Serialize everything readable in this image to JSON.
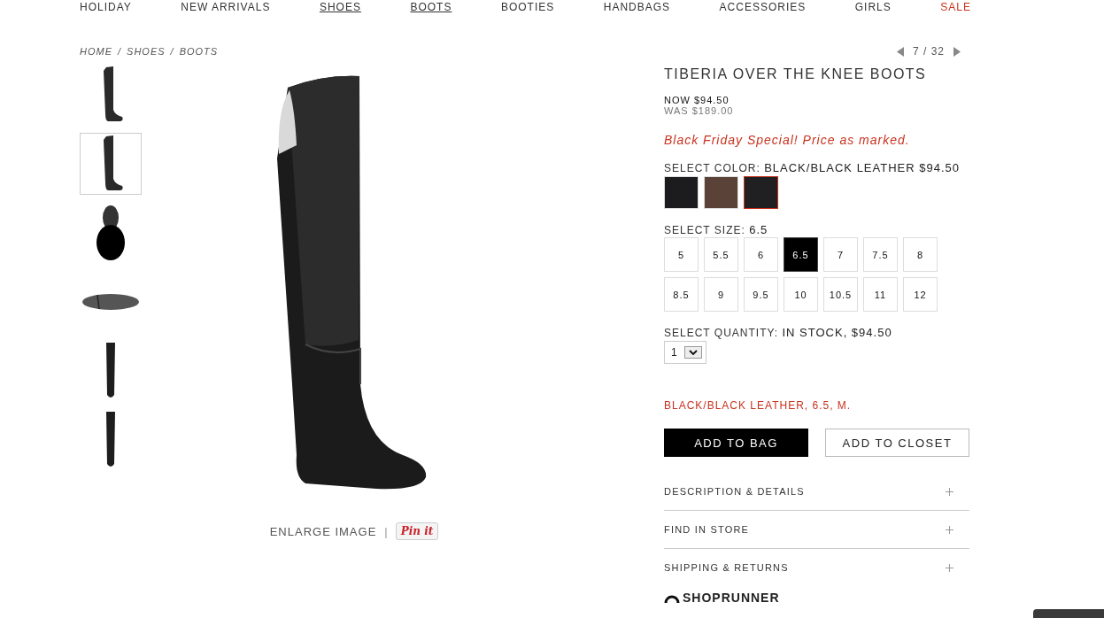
{
  "nav": [
    {
      "label": "HOLIDAY",
      "selected": false,
      "kind": "normal"
    },
    {
      "label": "NEW ARRIVALS",
      "selected": false,
      "kind": "normal"
    },
    {
      "label": "SHOES",
      "selected": true,
      "kind": "normal"
    },
    {
      "label": "BOOTS",
      "selected": true,
      "kind": "normal"
    },
    {
      "label": "BOOTIES",
      "selected": false,
      "kind": "normal"
    },
    {
      "label": "HANDBAGS",
      "selected": false,
      "kind": "normal"
    },
    {
      "label": "ACCESSORIES",
      "selected": false,
      "kind": "normal"
    },
    {
      "label": "GIRLS",
      "selected": false,
      "kind": "normal"
    },
    {
      "label": "SALE",
      "selected": false,
      "kind": "sale"
    }
  ],
  "breadcrumb": [
    "HOME",
    "SHOES",
    "BOOTS"
  ],
  "breadcrumb_separator": "/",
  "thumbnails": [
    {
      "kind": "side",
      "selected": false
    },
    {
      "kind": "side",
      "selected": true
    },
    {
      "kind": "top",
      "selected": false
    },
    {
      "kind": "sole",
      "selected": false
    },
    {
      "kind": "front",
      "selected": false
    },
    {
      "kind": "back",
      "selected": false
    }
  ],
  "image_actions": {
    "enlarge": "ENLARGE IMAGE",
    "separator": "|",
    "pin": "Pin it"
  },
  "pager": "7 / 32",
  "product": {
    "title": "TIBERIA OVER THE KNEE BOOTS",
    "now_price": "NOW $94.50",
    "was_price": "WAS $189.00",
    "promo": "Black Friday Special! Price as marked.",
    "color_label": "SELECT COLOR:",
    "color_value": "BLACK/BLACK LEATHER $94.50",
    "swatches": [
      {
        "color": "#1c1c1e",
        "selected": false
      },
      {
        "color": "#5b4238",
        "selected": false
      },
      {
        "color": "#202022",
        "selected": true
      }
    ],
    "size_label": "SELECT SIZE:",
    "size_value": "6.5",
    "sizes": [
      {
        "label": "5",
        "selected": false
      },
      {
        "label": "5.5",
        "selected": false
      },
      {
        "label": "6",
        "selected": false
      },
      {
        "label": "6.5",
        "selected": true
      },
      {
        "label": "7",
        "selected": false
      },
      {
        "label": "7.5",
        "selected": false
      },
      {
        "label": "8",
        "selected": false
      },
      {
        "label": "8.5",
        "selected": false
      },
      {
        "label": "9",
        "selected": false
      },
      {
        "label": "9.5",
        "selected": false
      },
      {
        "label": "10",
        "selected": false
      },
      {
        "label": "10.5",
        "selected": false
      },
      {
        "label": "11",
        "selected": false
      },
      {
        "label": "12",
        "selected": false
      }
    ],
    "quantity_label": "SELECT QUANTITY:",
    "quantity_value": "IN STOCK, $94.50",
    "quantity": "1",
    "selection_summary": "BLACK/BLACK LEATHER, 6.5, M.",
    "buttons": [
      {
        "label": "ADD TO BAG",
        "kind": "primary"
      },
      {
        "label": "ADD TO CLOSET",
        "kind": "secondary"
      }
    ],
    "sections": [
      {
        "label": "DESCRIPTION & DETAILS",
        "expanded": false
      },
      {
        "label": "FIND IN STORE",
        "expanded": false
      },
      {
        "label": "SHIPPING & RETURNS",
        "expanded": false
      }
    ],
    "shoprunner": "SHOPRUNNER"
  }
}
